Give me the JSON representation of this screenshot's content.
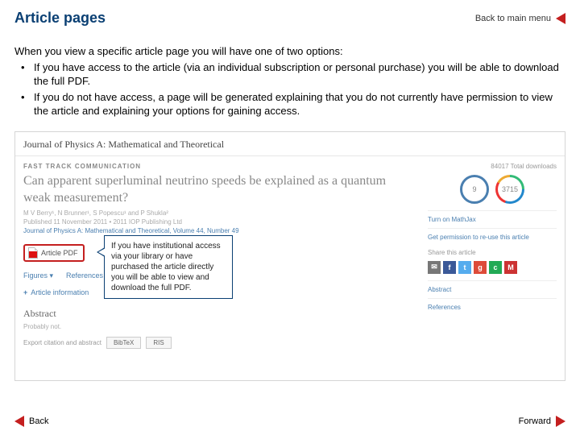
{
  "header": {
    "title": "Article pages",
    "back_main": "Back to main menu"
  },
  "intro": "When you view a specific article page you will have one of two options:",
  "bullets": [
    "If you have access to the article (via an individual subscription or personal purchase) you will be able to download the full PDF.",
    "If you do not have access, a page will be generated explaining that you do not currently have permission to view the article and explaining your options for gaining access."
  ],
  "callout": "If you have institutional access via your library or have purchased the article directly you will be able to view and download the full PDF.",
  "article": {
    "journal": "Journal of Physics A: Mathematical and Theoretical",
    "tag": "FAST TRACK COMMUNICATION",
    "title": "Can apparent superluminal neutrino speeds be explained as a quantum weak measurement?",
    "authors": "M V Berry¹, N Brunner¹, S Popescu¹ and P Shukla²",
    "published": "Published 11 November 2011 • 2011 IOP Publishing Ltd",
    "breadcrumb": "Journal of Physics A: Mathematical and Theoretical, Volume 44, Number 49",
    "pdf_label": "Article PDF",
    "tabs": {
      "figures": "Figures ▾",
      "references": "References"
    },
    "info": "Article information",
    "abstract_heading": "Abstract",
    "abstract_text": "Probably not.",
    "export_label": "Export citation and abstract",
    "export_buttons": [
      "BibTeX",
      "RIS"
    ]
  },
  "sidebar": {
    "downloads_label": "84017 Total downloads",
    "circle1": "9",
    "circle2": "3715",
    "mathjax": "Turn on MathJax",
    "permission": "Get permission to re-use this article",
    "share_label": "Share this article",
    "abstract_link": "Abstract",
    "references_link": "References"
  },
  "footer": {
    "back": "Back",
    "forward": "Forward"
  }
}
